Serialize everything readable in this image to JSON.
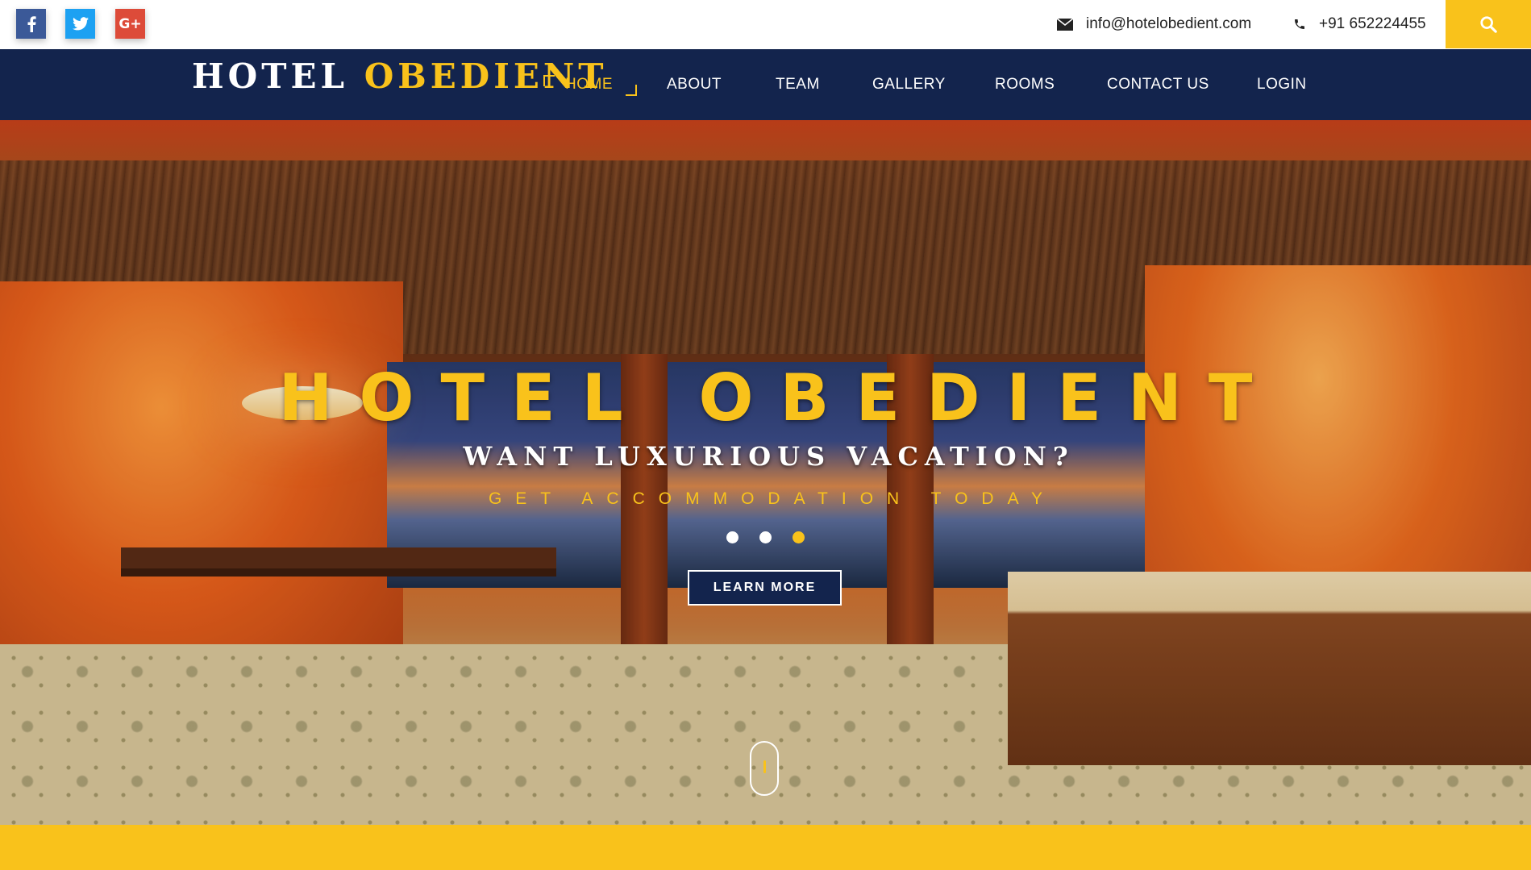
{
  "colors": {
    "accent": "#f9c21b",
    "navy": "#13244d",
    "white": "#ffffff"
  },
  "topbar": {
    "social": [
      {
        "name": "facebook-icon",
        "glyph": "f"
      },
      {
        "name": "twitter-icon",
        "glyph": "t"
      },
      {
        "name": "google-plus-icon",
        "glyph": "G+"
      }
    ],
    "email": "info@hotelobedient.com",
    "phone": "+91 652224455",
    "search_icon": "search-icon"
  },
  "nav": {
    "brand_first": "HOTEL",
    "brand_second": "OBEDIENT",
    "items": [
      "HOME",
      "ABOUT",
      "TEAM",
      "GALLERY",
      "ROOMS",
      "CONTACT US",
      "LOGIN"
    ],
    "active": "HOME"
  },
  "hero": {
    "title": "HOTEL OBEDIENT",
    "subtitle": "WANT LUXURIOUS VACATION?",
    "tagline": "GET ACCOMMODATION TODAY",
    "slides": 3,
    "active_slide": 3,
    "button_label": "LEARN MORE",
    "scroll_icon": "scroll-down-icon"
  }
}
